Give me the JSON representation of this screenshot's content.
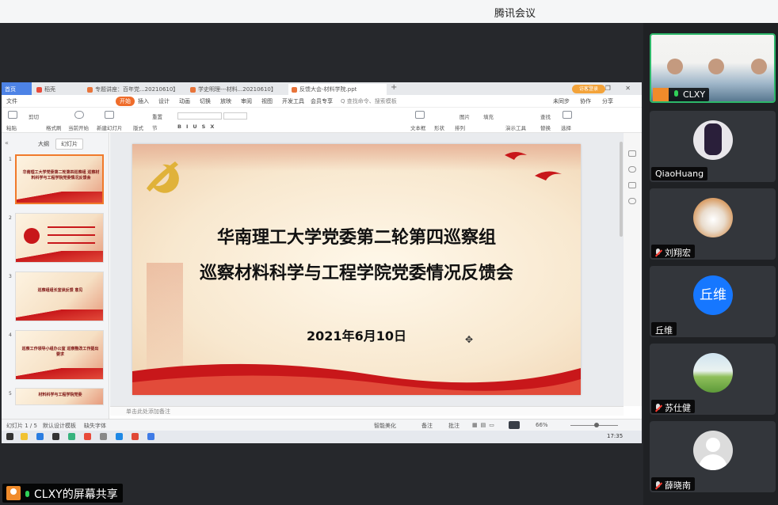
{
  "app": {
    "title": "腾讯会议"
  },
  "wps": {
    "tabs": [
      {
        "label": "首页",
        "color": "#4d83e6"
      },
      {
        "label": "稻壳",
        "color": "#e84a3a"
      },
      {
        "label": "专题讲座：百年党...20210610】",
        "color": "#e8743a"
      },
      {
        "label": "学史明理---材料...20210610】",
        "color": "#e8743a"
      },
      {
        "label": "反馈大会-材料学院.ppt",
        "color": "#e8743a"
      }
    ],
    "login_label": "访客登录",
    "menu": [
      "文件",
      "开始",
      "插入",
      "设计",
      "动画",
      "切换",
      "放映",
      "审阅",
      "视图",
      "开发工具",
      "会员专享"
    ],
    "menu_search": "Q 查找命令、搜索模板",
    "menu_right": [
      "未同步",
      "协作",
      "分享"
    ],
    "ribbon": [
      "粘贴",
      "剪切",
      "格式刷",
      "当前开始",
      "新建幻灯片",
      "版式",
      "节",
      "重置",
      "文本框",
      "形状",
      "排列",
      "图片",
      "填充",
      "演示工具",
      "查找",
      "替换",
      "选择"
    ],
    "panel_tabs": [
      "大纲",
      "幻灯片"
    ],
    "thumbs": [
      {
        "num": "1",
        "text": "华南理工大学党委第二轮第四巡察组 巡察材料科学与工程学院党委情况反馈会"
      },
      {
        "num": "2",
        "text": ""
      },
      {
        "num": "3",
        "text": "巡察组组长宣读反馈 意见"
      },
      {
        "num": "4",
        "text": "巡察工作领导小组办公室 巡察整改工作提出要求"
      },
      {
        "num": "5",
        "text": "材料科学与工程学院党委"
      }
    ],
    "slide": {
      "title1": "华南理工大学党委第二轮第四巡察组",
      "title2": "巡察材料科学与工程学院党委情况反馈会",
      "date": "2021年6月10日"
    },
    "notes_placeholder": "单击此处添加备注",
    "status": {
      "slide_count": "幻灯片 1 / 5",
      "theme": "默认设计模板",
      "font": "缺失字体",
      "protect": "智能美化",
      "notes": "备注",
      "comment": "批注",
      "zoom": "66%"
    },
    "clock": "17:35"
  },
  "participants": [
    {
      "name": "CLXY",
      "mic": "on",
      "avatar": "video"
    },
    {
      "name": "QiaoHuang",
      "mic": "none",
      "avatar": "anime"
    },
    {
      "name": "刘翔宏",
      "mic": "muted",
      "avatar": "cat"
    },
    {
      "name": "丘维",
      "mic": "none",
      "avatar": "text",
      "avatar_text": "丘维",
      "avatar_color": "#1677ff"
    },
    {
      "name": "苏仕健",
      "mic": "muted",
      "avatar": "landscape"
    },
    {
      "name": "薛晓南",
      "mic": "muted",
      "avatar": "default"
    }
  ],
  "share": {
    "label": "CLXY的屏幕共享"
  }
}
